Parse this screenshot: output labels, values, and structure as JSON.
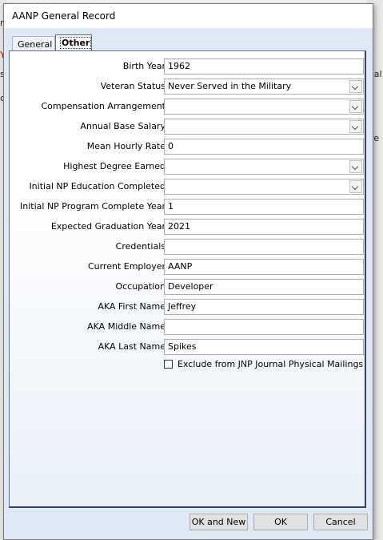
{
  "background": {
    "fragments": [
      "m",
      "Y",
      "s",
      "ca",
      "eal",
      "ire"
    ]
  },
  "dialog": {
    "title": "AANP General Record",
    "tabs": [
      {
        "label": "General",
        "active": false
      },
      {
        "label": "Other",
        "active": true
      }
    ],
    "fields": {
      "birth_year": {
        "label": "Birth Year",
        "value": "1962"
      },
      "veteran_status": {
        "label": "Veteran Status",
        "value": "Never Served in the Military"
      },
      "compensation_arrangement": {
        "label": "Compensation Arrangement",
        "value": ""
      },
      "annual_base_salary": {
        "label": "Annual Base Salary",
        "value": ""
      },
      "mean_hourly_rate": {
        "label": "Mean Hourly Rate",
        "value": "0"
      },
      "highest_degree_earned": {
        "label": "Highest Degree Earned",
        "value": ""
      },
      "initial_np_education_completed": {
        "label": "Initial NP Education Completed",
        "value": ""
      },
      "initial_np_program_complete_year": {
        "label": "Initial NP Program Complete Year",
        "value": "1"
      },
      "expected_graduation_year": {
        "label": "Expected Graduation Year",
        "value": "2021"
      },
      "credentials": {
        "label": "Credentials",
        "value": ""
      },
      "current_employer": {
        "label": "Current Employer",
        "value": "AANP"
      },
      "occupation": {
        "label": "Occupation",
        "value": "Developer"
      },
      "aka_first_name": {
        "label": "AKA First Name",
        "value": "Jeffrey"
      },
      "aka_middle_name": {
        "label": "AKA Middle Name",
        "value": ""
      },
      "aka_last_name": {
        "label": "AKA Last Name",
        "value": "Spikes"
      }
    },
    "exclude_checkbox": {
      "label": "Exclude from JNP Journal Physical Mailings",
      "checked": false
    },
    "buttons": {
      "ok_and_new": "OK and New",
      "ok": "OK",
      "cancel": "Cancel"
    }
  }
}
